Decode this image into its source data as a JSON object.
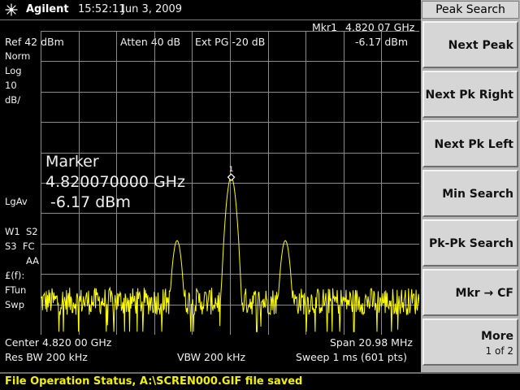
{
  "header": {
    "brand": "Agilent",
    "time": "15:52:11",
    "date": "Jun 3, 2009"
  },
  "top_readouts": {
    "marker_label": "Mkr1",
    "marker_freq": "4.820 07 GHz",
    "ref_level": "Ref 42 dBm",
    "atten": "Atten 40 dB",
    "ext_pg": "Ext PG -20 dB",
    "marker_amp": "-6.17 dBm"
  },
  "left_annotations": {
    "norm": "Norm",
    "log": "Log",
    "scale": "10",
    "scale_unit": "dB/",
    "lgav": "LgAv",
    "w1s2": "W1  S2",
    "s3fc": "S3  FC",
    "aa": "AA",
    "ff": "£(f):",
    "ftun": "FTun",
    "swp": "Swp"
  },
  "marker_readout": {
    "title": "Marker",
    "freq": "4.820070000 GHz",
    "amp": " -6.17 dBm",
    "marker_number": "1"
  },
  "bottom_readouts": {
    "center": "Center 4.820 00 GHz",
    "span": "Span 20.98 MHz",
    "res_bw": "Res BW 200 kHz",
    "vbw": "VBW 200 kHz",
    "sweep": "Sweep 1 ms (601 pts)"
  },
  "status": {
    "text": "File Operation Status, A:\\SCREN000.GIF file saved"
  },
  "softkeys": {
    "title": "Peak Search",
    "keys": [
      {
        "label": "Next Peak"
      },
      {
        "label": "Next Pk Right"
      },
      {
        "label": "Next Pk Left"
      },
      {
        "label": "Min Search"
      },
      {
        "label": "Pk-Pk Search"
      },
      {
        "label": "Mkr → CF"
      },
      {
        "label": "More",
        "sub": "1 of 2"
      }
    ]
  },
  "chart_data": {
    "type": "line",
    "center_ghz": 4.82,
    "span_mhz": 20.98,
    "ref_level_dbm": 42,
    "scale_db_per_div": 10,
    "divisions": 10,
    "points": 601,
    "noise_floor_dbm": -47,
    "peaks": [
      {
        "freq_ghz": 4.81707,
        "amp_dbm": -27
      },
      {
        "freq_ghz": 4.82007,
        "amp_dbm": -6.17
      },
      {
        "freq_ghz": 4.82307,
        "amp_dbm": -27
      }
    ],
    "trace_color": "#ffff00",
    "grid": true
  }
}
